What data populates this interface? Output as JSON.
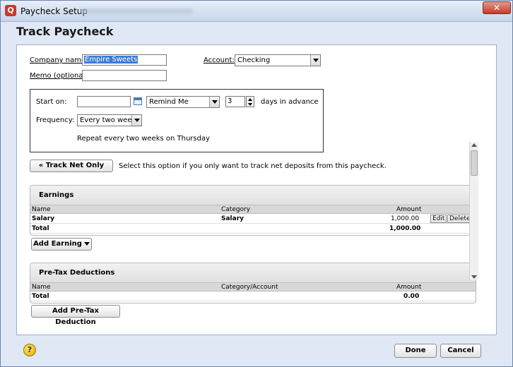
{
  "window": {
    "title": "Paycheck Setup",
    "header": "Track Paycheck",
    "close_glyph": "✕"
  },
  "form": {
    "company_label": "Company name:",
    "company_value": "Empire Sweets",
    "memo_label": "Memo (optional):",
    "memo_value": "",
    "account_label": "Account:",
    "account_value": "Checking"
  },
  "schedule": {
    "start_label": "Start on:",
    "start_value": "",
    "remind_value": "Remind Me",
    "days_value": "3",
    "days_label": "days in advance",
    "frequency_label": "Frequency:",
    "frequency_value": "Every two weeks",
    "repeat_text": "Repeat every two weeks on Thursday"
  },
  "track_net": {
    "button_label": "« Track Net Only",
    "description": "Select this option if you only want to track net deposits from this paycheck."
  },
  "earnings": {
    "title": "Earnings",
    "columns": [
      "Name",
      "Category",
      "Amount"
    ],
    "rows": [
      {
        "name": "Salary",
        "category": "Salary",
        "amount": "1,000.00",
        "edit": "Edit",
        "delete": "Delete"
      }
    ],
    "total_label": "Total",
    "total_amount": "1,000.00",
    "add_button": "Add Earning"
  },
  "pretax": {
    "title": "Pre-Tax Deductions",
    "columns": [
      "Name",
      "Category/Account",
      "Amount"
    ],
    "total_label": "Total",
    "total_amount": "0.00",
    "add_button": "Add Pre-Tax Deduction"
  },
  "footer": {
    "help_glyph": "?",
    "done": "Done",
    "cancel": "Cancel"
  }
}
